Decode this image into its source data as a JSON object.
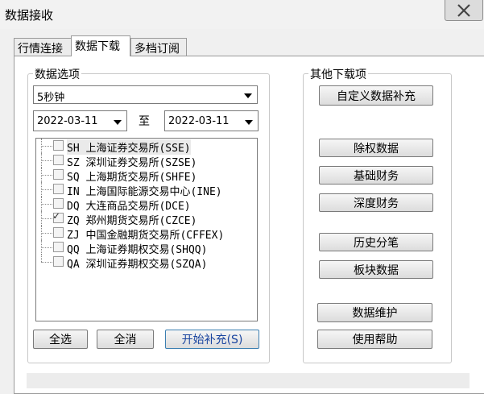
{
  "window": {
    "title": "数据接收"
  },
  "tabs": [
    {
      "label": "行情连接"
    },
    {
      "label": "数据下载"
    },
    {
      "label": "多档订阅"
    }
  ],
  "data_options": {
    "group_label": "数据选项",
    "period_select": "5秒钟",
    "date_from": "2022-03-11",
    "to_label": "至",
    "date_to": "2022-03-11",
    "markets": [
      {
        "code": "SH",
        "name": "上海证券交易所(SSE)",
        "checked": false
      },
      {
        "code": "SZ",
        "name": "深圳证券交易所(SZSE)",
        "checked": false
      },
      {
        "code": "SQ",
        "name": "上海期货交易所(SHFE)",
        "checked": false
      },
      {
        "code": "IN",
        "name": "上海国际能源交易中心(INE)",
        "checked": false
      },
      {
        "code": "DQ",
        "name": "大连商品交易所(DCE)",
        "checked": false
      },
      {
        "code": "ZQ",
        "name": "郑州期货交易所(CZCE)",
        "checked": true
      },
      {
        "code": "ZJ",
        "name": "中国金融期货交易所(CFFEX)",
        "checked": false
      },
      {
        "code": "QQ",
        "name": "上海证券期权交易(SHQQ)",
        "checked": false
      },
      {
        "code": "QA",
        "name": "深圳证券期权交易(SZQA)",
        "checked": false
      }
    ],
    "select_all": "全选",
    "deselect_all": "全消",
    "start_fill": "开始补充(S)"
  },
  "other_downloads": {
    "group_label": "其他下载项",
    "custom_fill": "自定义数据补充",
    "ex_rights": "除权数据",
    "fundamentals": "基础财务",
    "deep_finance": "深度财务",
    "tick_history": "历史分笔",
    "sector_data": "板块数据",
    "maintenance": "数据维护",
    "help": "使用帮助"
  }
}
